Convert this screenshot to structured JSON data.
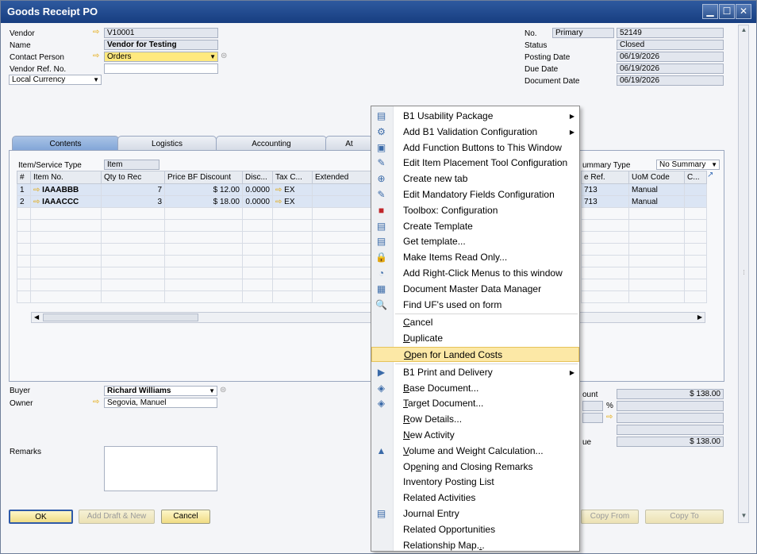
{
  "window": {
    "title": "Goods Receipt PO"
  },
  "header_left": {
    "vendor_label": "Vendor",
    "vendor_value": "V10001",
    "name_label": "Name",
    "name_value": "Vendor for Testing",
    "contact_label": "Contact Person",
    "contact_value": "Orders",
    "vendor_ref_label": "Vendor Ref. No.",
    "vendor_ref_value": "",
    "currency_value": "Local Currency"
  },
  "header_right": {
    "no_label": "No.",
    "series": "Primary",
    "no_value": "52149",
    "status_label": "Status",
    "status_value": "Closed",
    "posting_label": "Posting Date",
    "posting_value": "06/19/2026",
    "due_label": "Due Date",
    "due_value": "06/19/2026",
    "docdate_label": "Document Date",
    "docdate_value": "06/19/2026"
  },
  "tabs": [
    "Contents",
    "Logistics",
    "Accounting",
    "At"
  ],
  "contents": {
    "type_label": "Item/Service Type",
    "type_value": "Item",
    "summary_label": "ummary Type",
    "summary_value": "No Summary",
    "columns": [
      "#",
      "Item No.",
      "Qty to Rec",
      "Price BF Discount",
      "Disc...",
      "Tax C...",
      "Extended"
    ],
    "columns_right": [
      "e Ref.",
      "UoM Code",
      "C..."
    ],
    "rows": [
      {
        "num": "1",
        "item": "IAAABBB",
        "qty": "7",
        "price": "$ 12.00",
        "disc": "0.0000",
        "tax": "EX",
        "ref": "713",
        "uom": "Manual"
      },
      {
        "num": "2",
        "item": "IAAACCC",
        "qty": "3",
        "price": "$ 18.00",
        "disc": "0.0000",
        "tax": "EX",
        "ref": "713",
        "uom": "Manual"
      }
    ]
  },
  "footer_left": {
    "buyer_label": "Buyer",
    "buyer_value": "Richard Williams",
    "owner_label": "Owner",
    "owner_value": "Segovia, Manuel",
    "remarks_label": "Remarks"
  },
  "footer_right": {
    "total_before_label": "ount",
    "total_before_value": "$ 138.00",
    "percent_symbol": "%",
    "total_label": "ue",
    "total_value": "$ 138.00"
  },
  "buttons": {
    "ok": "OK",
    "add_draft": "Add Draft & New",
    "cancel": "Cancel",
    "copy_from": "Copy From",
    "copy_to": "Copy To"
  },
  "menu": {
    "items": [
      {
        "label": "B1 Usability Package",
        "icon": "usability-icon",
        "glyph": "▤",
        "submenu": true
      },
      {
        "label": "Add B1 Validation Configuration",
        "icon": "validation-gear-icon",
        "glyph": "⚙",
        "submenu": true
      },
      {
        "label": "Add Function Buttons to This Window",
        "icon": "function-button-icon",
        "glyph": "▣"
      },
      {
        "label": "Edit Item Placement Tool Configuration",
        "icon": "placement-tool-icon",
        "glyph": "✎"
      },
      {
        "label": "Create new tab",
        "icon": "new-tab-icon",
        "glyph": "⊕"
      },
      {
        "label": "Edit Mandatory Fields Configuration",
        "icon": "mandatory-fields-icon",
        "glyph": "✎"
      },
      {
        "label": "Toolbox: Configuration",
        "icon": "toolbox-icon",
        "glyph": "■"
      },
      {
        "label": "Create Template",
        "icon": "template-icon",
        "glyph": "▤"
      },
      {
        "label": "Get template...",
        "icon": "get-template-icon",
        "glyph": "▤"
      },
      {
        "label": "Make Items Read Only...",
        "icon": "lock-icon",
        "glyph": "🔒"
      },
      {
        "label": "Add Right-Click Menus to this window",
        "icon": "mouse-icon",
        "glyph": "◔"
      },
      {
        "label": "Document Master Data Manager",
        "icon": "data-manager-icon",
        "glyph": "▦"
      },
      {
        "label": "Find UF's used on form",
        "icon": "search-icon",
        "glyph": "🔍"
      }
    ],
    "items2": [
      {
        "label": "Cancel"
      },
      {
        "label": "Duplicate"
      },
      {
        "label": "Open for Landed Costs",
        "highlight": true
      }
    ],
    "items3": [
      {
        "label": "B1 Print and Delivery",
        "icon": "print-delivery-icon",
        "glyph": "▶",
        "submenu": true
      },
      {
        "label": "Base Document...",
        "icon": "base-document-icon",
        "glyph": "◈"
      },
      {
        "label": "Target Document...",
        "icon": "target-document-icon",
        "glyph": "◈"
      },
      {
        "label": "Row Details..."
      },
      {
        "label": "New Activity"
      },
      {
        "label": "Volume and Weight Calculation...",
        "icon": "volume-weight-icon",
        "glyph": "▲"
      },
      {
        "label": "Opening and Closing Remarks"
      },
      {
        "label": "Inventory Posting List"
      },
      {
        "label": "Related Activities"
      },
      {
        "label": "Journal Entry",
        "icon": "journal-entry-icon",
        "glyph": "▤"
      },
      {
        "label": "Related Opportunities"
      },
      {
        "label": "Relationship Map..."
      }
    ]
  }
}
